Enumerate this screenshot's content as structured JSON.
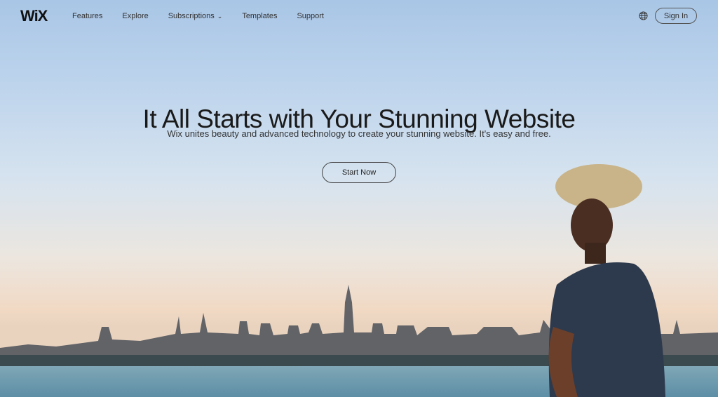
{
  "nav": {
    "logo": "WiX",
    "items": [
      {
        "label": "Features"
      },
      {
        "label": "Explore"
      },
      {
        "label": "Subscriptions",
        "chevron": "⌄"
      },
      {
        "label": "Templates"
      },
      {
        "label": "Support"
      }
    ],
    "language_icon": "globe-icon",
    "signin_label": "Sign In"
  },
  "hero": {
    "title": "It All Starts with Your Stunning Website",
    "subtitle": "Wix unites beauty and advanced technology to create your stunning website. It's easy and free.",
    "cta_label": "Start Now"
  }
}
